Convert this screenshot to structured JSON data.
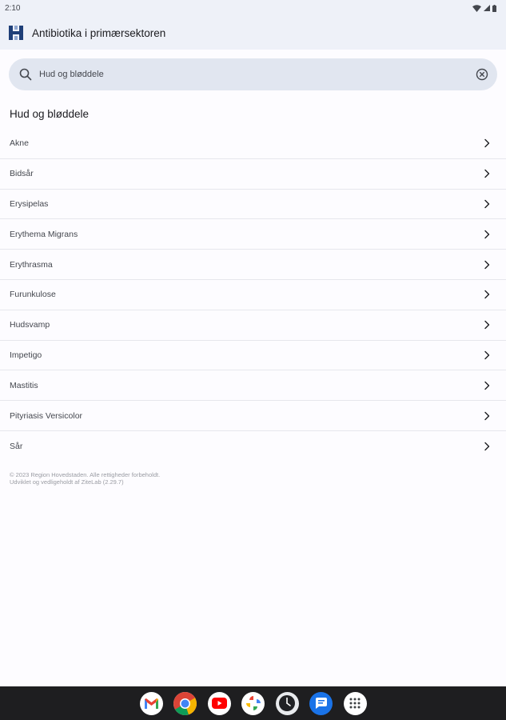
{
  "status_bar": {
    "time": "2:10"
  },
  "app_bar": {
    "title": "Antibiotika i primærsektoren"
  },
  "search": {
    "value": "Hud og bløddele"
  },
  "section": {
    "title": "Hud og bløddele"
  },
  "items": [
    {
      "label": "Akne"
    },
    {
      "label": "Bidsår"
    },
    {
      "label": "Erysipelas"
    },
    {
      "label": "Erythema Migrans"
    },
    {
      "label": "Erythrasma"
    },
    {
      "label": "Furunkulose"
    },
    {
      "label": "Hudsvamp"
    },
    {
      "label": "Impetigo"
    },
    {
      "label": "Mastitis"
    },
    {
      "label": "Pityriasis Versicolor"
    },
    {
      "label": "Sår"
    }
  ],
  "footer": {
    "line1": "© 2023 Region Hovedstaden. Alle rettigheder forbeholdt.",
    "line2": "Udviklet og vedligeholdt af ZiteLab (2.29.7)"
  },
  "dock": [
    {
      "icon": "gmail-icon"
    },
    {
      "icon": "chrome-icon"
    },
    {
      "icon": "youtube-icon"
    },
    {
      "icon": "photos-icon"
    },
    {
      "icon": "clock-icon"
    },
    {
      "icon": "messages-icon"
    },
    {
      "icon": "app-drawer-icon"
    }
  ],
  "colors": {
    "app_bar_bg": "#eef1f8",
    "search_bg": "#e1e6f0",
    "logo_blue": "#1f3f78",
    "taskbar_bg": "#1e1e20"
  }
}
